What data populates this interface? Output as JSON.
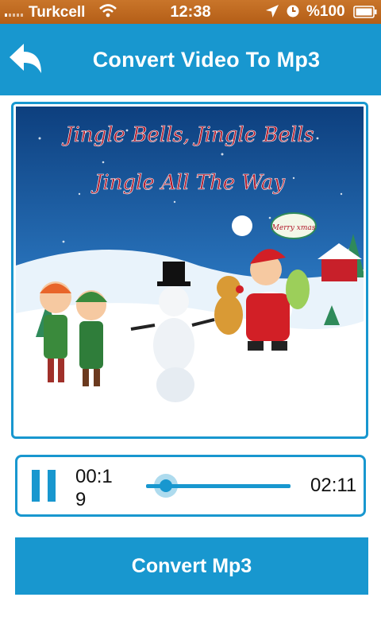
{
  "status_bar": {
    "carrier": "Turkcell",
    "time": "12:38",
    "battery_text": "%100",
    "icons": [
      "signal-icon",
      "wifi-icon",
      "location-arrow-icon",
      "alarm-clock-icon",
      "battery-icon"
    ]
  },
  "header": {
    "title": "Convert Video To Mp3",
    "back_icon": "back-arrow-icon"
  },
  "video": {
    "caption_line1": "Jingle Bells, Jingle Bells",
    "caption_line2": "Jingle All The Way",
    "sign_text": "Merry xmas"
  },
  "player": {
    "current_time": "00:19",
    "total_time": "02:11",
    "progress": 0.14,
    "state_icon": "pause-icon"
  },
  "convert_button": {
    "label": "Convert Mp3"
  },
  "colors": {
    "accent": "#1897cf",
    "status_bar": "#c0692a"
  }
}
